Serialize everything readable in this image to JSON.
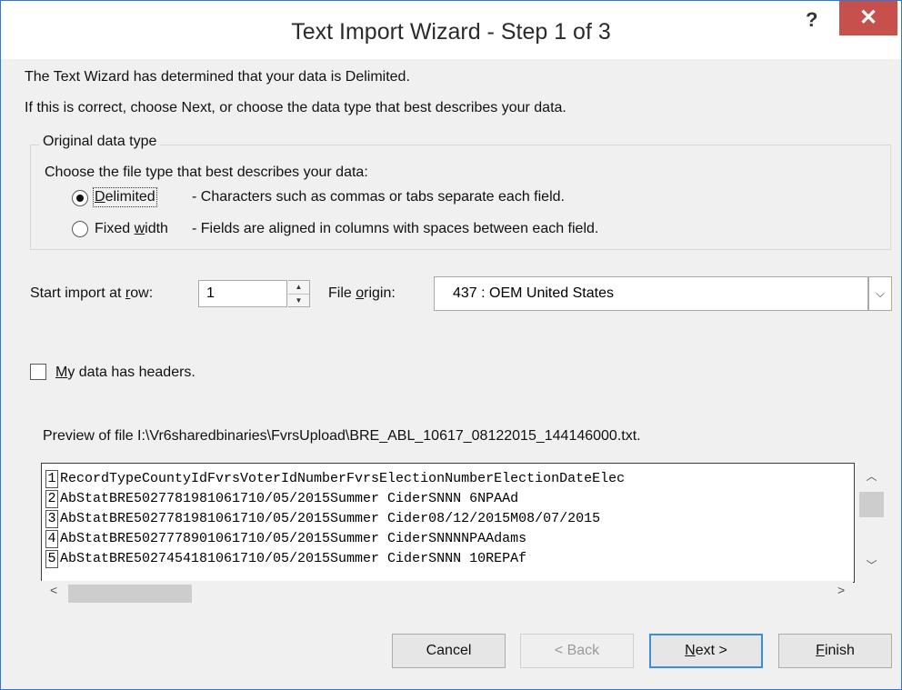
{
  "window": {
    "title": "Text Import Wizard - Step 1 of 3",
    "help_label": "?",
    "close_label": "✕"
  },
  "intro": {
    "line1": "The Text Wizard has determined that your data is Delimited.",
    "line2": "If this is correct, choose Next, or choose the data type that best describes your data."
  },
  "original_data_type": {
    "legend": "Original data type",
    "prompt": "Choose the file type that best describes your data:",
    "options": [
      {
        "pre": "",
        "u": "D",
        "post": "elimited",
        "description": "- Characters such as commas or tabs separate each field.",
        "checked": true
      },
      {
        "pre": "Fixed ",
        "u": "w",
        "post": "idth",
        "description": "- Fields are aligned in columns with spaces between each field.",
        "checked": false
      }
    ]
  },
  "start_import": {
    "pre": "Start import at ",
    "u": "r",
    "post": "ow:",
    "value": "1"
  },
  "file_origin": {
    "pre": "File ",
    "u": "o",
    "post": "rigin:",
    "value": "437 : OEM United States"
  },
  "headers_checkbox": {
    "u": "M",
    "post": "y data has headers.",
    "checked": false
  },
  "preview": {
    "label": "Preview of file I:\\Vr6sharedbinaries\\FvrsUpload\\BRE_ABL_10617_08122015_144146000.txt.",
    "rows": [
      {
        "num": "1",
        "text": "RecordTypeCountyIdFvrsVoterIdNumberFvrsElectionNumberElectionDateElec"
      },
      {
        "num": "2",
        "text": "AbStatBRE5027781981061710/05/2015Summer CiderSNNN  6NPAAd"
      },
      {
        "num": "3",
        "text": "AbStatBRE5027781981061710/05/2015Summer Cider08/12/2015M08/07/2015"
      },
      {
        "num": "4",
        "text": "AbStatBRE5027778901061710/05/2015Summer CiderSNNNNPAAdams"
      },
      {
        "num": "5",
        "text": "AbStatBRE5027454181061710/05/2015Summer CiderSNNN 10REPAf"
      }
    ]
  },
  "buttons": {
    "cancel": "Cancel",
    "back": "< Back",
    "next_u": "N",
    "next_post": "ext >",
    "finish_u": "F",
    "finish_post": "inish"
  }
}
